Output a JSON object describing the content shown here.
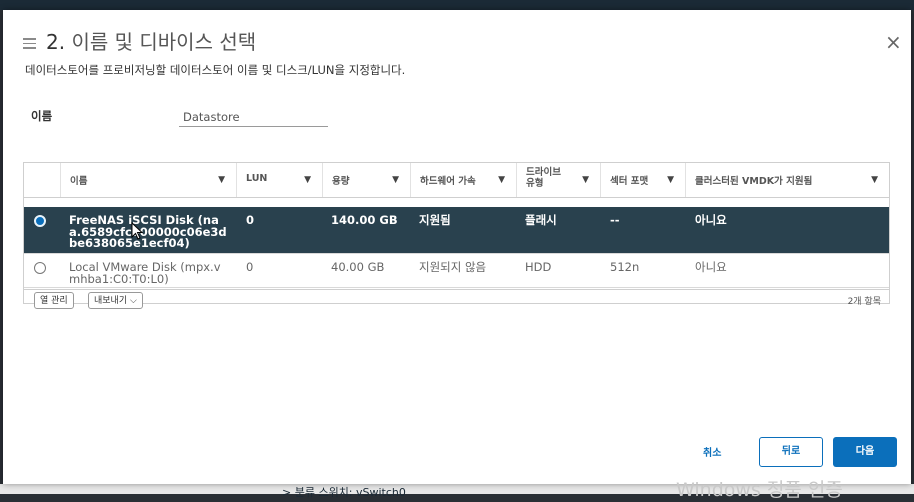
{
  "background": {
    "bottom_peek_text": "> 분류 스위치: vSwitch0",
    "watermark": "Windows 정품 인증"
  },
  "dialog": {
    "step_number": "2.",
    "title": "이름 및 디바이스 선택",
    "subtitle": "데이터스토어를 프로비저닝할 데이터스토어 이름 및 디스크/LUN을 지정합니다.",
    "menu_icon": "hamburger-icon",
    "close_icon": "close-icon"
  },
  "name_field": {
    "label": "이름",
    "value": "Datastore"
  },
  "grid": {
    "columns": [
      {
        "label": "이름"
      },
      {
        "label": "LUN"
      },
      {
        "label": "용량"
      },
      {
        "label": "하드웨어 가속"
      },
      {
        "label": "드라이브\n유형"
      },
      {
        "label": "섹터 포맷"
      },
      {
        "label": "클러스터된 VMDK가 지원됨"
      }
    ],
    "rows": [
      {
        "selected": true,
        "name": "FreeNAS iSCSI Disk (naa.6589cfc000000c06e3dbe638065e1ecf04)",
        "lun": "0",
        "capacity": "140.00 GB",
        "hw_accel": "지원됨",
        "drive_type": "플래시",
        "sector_format": "--",
        "clustered_vmdk": "아니요"
      },
      {
        "selected": false,
        "name": "Local VMware Disk (mpx.vmhba1:C0:T0:L0)",
        "lun": "0",
        "capacity": "40.00 GB",
        "hw_accel": "지원되지 않음",
        "drive_type": "HDD",
        "sector_format": "512n",
        "clustered_vmdk": "아니요"
      }
    ],
    "footer": {
      "manage_columns": "열 관리",
      "export": "내보내기 ⌵",
      "count": "2개 항목"
    }
  },
  "buttons": {
    "cancel": "취소",
    "back": "뒤로",
    "next": "다음"
  },
  "colors": {
    "accent": "#0b6fbb",
    "selected_row": "#29414e"
  }
}
